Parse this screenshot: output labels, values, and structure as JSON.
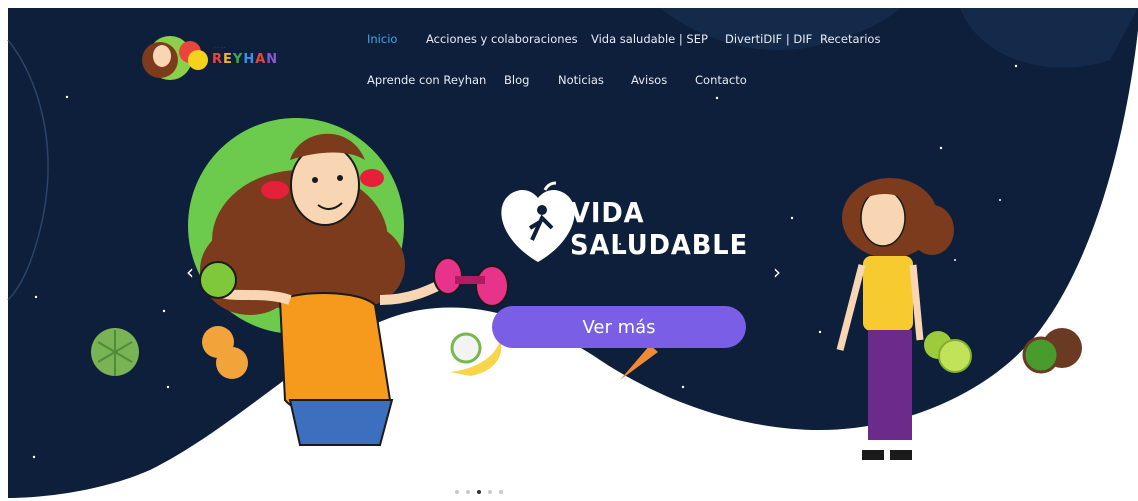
{
  "brand": {
    "name": "REYHAN",
    "letters": [
      "R",
      "E",
      "Y",
      "H",
      "A",
      "N"
    ],
    "letter_colors": [
      "#e8463d",
      "#f5b12b",
      "#42a948",
      "#3b8fe0",
      "#e8463d",
      "#8a56d3"
    ]
  },
  "nav": {
    "row1": [
      {
        "label": "Inicio",
        "active": true
      },
      {
        "label": "Acciones y colaboraciones",
        "active": false
      },
      {
        "label": "Vida saludable | SEP",
        "active": false
      },
      {
        "label": "DivertiDIF | DIF",
        "active": false
      },
      {
        "label": "Recetarios",
        "active": false
      }
    ],
    "row2": [
      {
        "label": "Aprende con Reyhan",
        "active": false
      },
      {
        "label": "Blog",
        "active": false
      },
      {
        "label": "Noticias",
        "active": false
      },
      {
        "label": "Avisos",
        "active": false
      },
      {
        "label": "Contacto",
        "active": false
      }
    ]
  },
  "hero": {
    "headline_line1": "VIDA",
    "headline_line2": "SALUDABLE",
    "cta_label": "Ver más",
    "prev_icon": "chevron-left-icon",
    "next_icon": "chevron-right-icon",
    "prev_glyph": "‹",
    "next_glyph": "›"
  },
  "carousel": {
    "slide_count": 5,
    "active_index": 2
  },
  "colors": {
    "night": "#0d1f3a",
    "accent_active": "#3fa6e6",
    "cta": "#7a5ee6",
    "nav_text": "#e8ecf4"
  }
}
